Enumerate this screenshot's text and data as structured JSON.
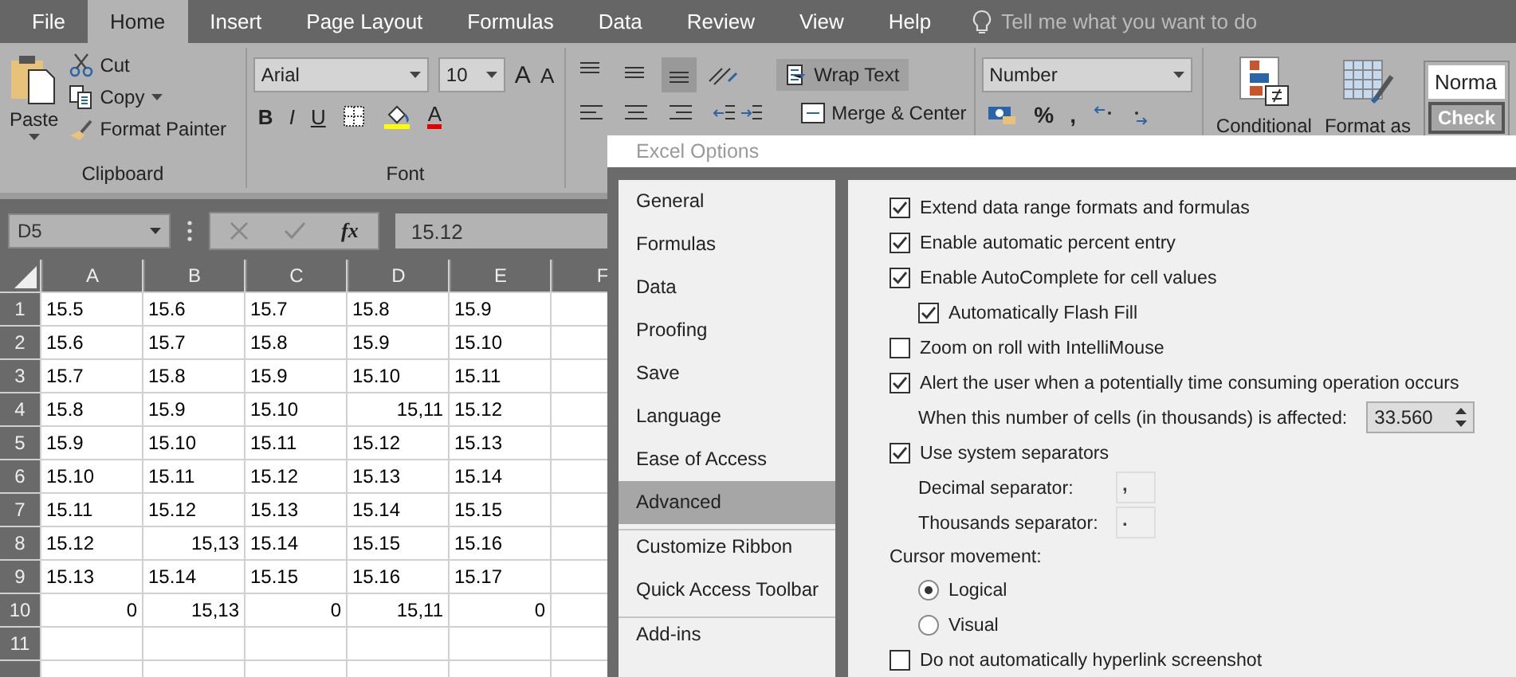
{
  "ribbon_tabs": [
    {
      "label": "File",
      "selected": false
    },
    {
      "label": "Home",
      "selected": true
    },
    {
      "label": "Insert",
      "selected": false
    },
    {
      "label": "Page Layout",
      "selected": false
    },
    {
      "label": "Formulas",
      "selected": false
    },
    {
      "label": "Data",
      "selected": false
    },
    {
      "label": "Review",
      "selected": false
    },
    {
      "label": "View",
      "selected": false
    },
    {
      "label": "Help",
      "selected": false
    }
  ],
  "tell_me": {
    "placeholder": "Tell me what you want to do"
  },
  "clipboard": {
    "paste": "Paste",
    "cut": "Cut",
    "copy": "Copy",
    "format_painter": "Format Painter",
    "label": "Clipboard"
  },
  "font": {
    "name": "Arial",
    "size": "10",
    "grow": "A",
    "shrink": "A",
    "bold": "B",
    "italic": "I",
    "underline": "U",
    "font_color_button": "A",
    "label": "Font"
  },
  "alignment": {
    "vertical": [
      {
        "kind": "top",
        "selected": false
      },
      {
        "kind": "middle",
        "selected": false
      },
      {
        "kind": "bottom",
        "selected": true
      }
    ],
    "wrap_text": {
      "label": "Wrap Text",
      "selected": true
    },
    "merge_center": "Merge & Center"
  },
  "number": {
    "format": "Number",
    "percent": "%",
    "comma": ","
  },
  "styles": {
    "conditional": "Conditional",
    "format_as": "Format as",
    "normal": "Norma",
    "check": "Check"
  },
  "formula_bar": {
    "name_box": "D5",
    "fx": "fx",
    "value": "15.12"
  },
  "sheet": {
    "columns": [
      "A",
      "B",
      "C",
      "D",
      "E",
      "F"
    ],
    "rows": [
      {
        "header": "1",
        "cells": [
          {
            "value": "15.5",
            "kind": "text"
          },
          {
            "value": "15.6",
            "kind": "text"
          },
          {
            "value": "15.7",
            "kind": "text"
          },
          {
            "value": "15.8",
            "kind": "text"
          },
          {
            "value": "15.9",
            "kind": "text"
          }
        ]
      },
      {
        "header": "2",
        "cells": [
          {
            "value": "15.6",
            "kind": "text"
          },
          {
            "value": "15.7",
            "kind": "text"
          },
          {
            "value": "15.8",
            "kind": "text"
          },
          {
            "value": "15.9",
            "kind": "text"
          },
          {
            "value": "15.10",
            "kind": "text"
          }
        ]
      },
      {
        "header": "3",
        "cells": [
          {
            "value": "15.7",
            "kind": "text"
          },
          {
            "value": "15.8",
            "kind": "text"
          },
          {
            "value": "15.9",
            "kind": "text"
          },
          {
            "value": "15.10",
            "kind": "text"
          },
          {
            "value": "15.11",
            "kind": "text"
          }
        ]
      },
      {
        "header": "4",
        "cells": [
          {
            "value": "15.8",
            "kind": "text"
          },
          {
            "value": "15.9",
            "kind": "text"
          },
          {
            "value": "15.10",
            "kind": "text"
          },
          {
            "value": "15,11",
            "kind": "number"
          },
          {
            "value": "15.12",
            "kind": "text"
          }
        ]
      },
      {
        "header": "5",
        "cells": [
          {
            "value": "15.9",
            "kind": "text"
          },
          {
            "value": "15.10",
            "kind": "text"
          },
          {
            "value": "15.11",
            "kind": "text"
          },
          {
            "value": "15.12",
            "kind": "text"
          },
          {
            "value": "15.13",
            "kind": "text"
          }
        ]
      },
      {
        "header": "6",
        "cells": [
          {
            "value": "15.10",
            "kind": "text"
          },
          {
            "value": "15.11",
            "kind": "text"
          },
          {
            "value": "15.12",
            "kind": "text"
          },
          {
            "value": "15.13",
            "kind": "text"
          },
          {
            "value": "15.14",
            "kind": "text"
          }
        ]
      },
      {
        "header": "7",
        "cells": [
          {
            "value": "15.11",
            "kind": "text"
          },
          {
            "value": "15.12",
            "kind": "text"
          },
          {
            "value": "15.13",
            "kind": "text"
          },
          {
            "value": "15.14",
            "kind": "text"
          },
          {
            "value": "15.15",
            "kind": "text"
          }
        ]
      },
      {
        "header": "8",
        "cells": [
          {
            "value": "15.12",
            "kind": "text"
          },
          {
            "value": "15,13",
            "kind": "number"
          },
          {
            "value": "15.14",
            "kind": "text"
          },
          {
            "value": "15.15",
            "kind": "text"
          },
          {
            "value": "15.16",
            "kind": "text"
          }
        ]
      },
      {
        "header": "9",
        "cells": [
          {
            "value": "15.13",
            "kind": "text"
          },
          {
            "value": "15.14",
            "kind": "text"
          },
          {
            "value": "15.15",
            "kind": "text"
          },
          {
            "value": "15.16",
            "kind": "text"
          },
          {
            "value": "15.17",
            "kind": "text"
          }
        ]
      },
      {
        "header": "10",
        "cells": [
          {
            "value": "0",
            "kind": "number"
          },
          {
            "value": "15,13",
            "kind": "number"
          },
          {
            "value": "0",
            "kind": "number"
          },
          {
            "value": "15,11",
            "kind": "number"
          },
          {
            "value": "0",
            "kind": "number"
          }
        ]
      },
      {
        "header": "11"
      }
    ]
  },
  "dialog": {
    "title": "Excel Options",
    "nav": [
      {
        "label": "General",
        "selected": false
      },
      {
        "label": "Formulas",
        "selected": false
      },
      {
        "label": "Data",
        "selected": false
      },
      {
        "label": "Proofing",
        "selected": false
      },
      {
        "label": "Save",
        "selected": false
      },
      {
        "label": "Language",
        "selected": false
      },
      {
        "label": "Ease of Access",
        "selected": false
      },
      {
        "label": "Advanced",
        "selected": true
      },
      {
        "label": "Customize Ribbon",
        "selected": false,
        "separator_before": true
      },
      {
        "label": "Quick Access Toolbar",
        "selected": false
      },
      {
        "label": "Add-ins",
        "selected": false,
        "separator_before": true
      }
    ],
    "options": [
      {
        "kind": "checkbox",
        "label": "Extend data range formats and formulas",
        "checked": true
      },
      {
        "kind": "checkbox",
        "label": "Enable automatic percent entry",
        "checked": true
      },
      {
        "kind": "checkbox",
        "label": "Enable AutoComplete for cell values",
        "checked": true,
        "children": [
          {
            "kind": "checkbox",
            "label": "Automatically Flash Fill",
            "checked": true
          }
        ]
      },
      {
        "kind": "checkbox",
        "label": "Zoom on roll with IntelliMouse",
        "checked": false
      },
      {
        "kind": "checkbox",
        "label": "Alert the user when a potentially time consuming operation occurs",
        "checked": true,
        "children": [
          {
            "kind": "spin",
            "label": "When this number of cells (in thousands) is affected:",
            "value": "33.560"
          }
        ]
      },
      {
        "kind": "checkbox",
        "label": "Use system separators",
        "checked": true,
        "children": [
          {
            "kind": "field",
            "label": "Decimal separator:",
            "value": ",",
            "disabled": true
          },
          {
            "kind": "field",
            "label": "Thousands separator:",
            "value": ".",
            "disabled": true
          }
        ]
      },
      {
        "kind": "heading",
        "label": "Cursor movement:",
        "children": [
          {
            "kind": "radio",
            "label": "Logical",
            "selected": true
          },
          {
            "kind": "radio",
            "label": "Visual",
            "selected": false
          }
        ]
      },
      {
        "kind": "checkbox",
        "label": "Do not automatically hyperlink screenshot",
        "checked": false
      }
    ]
  }
}
